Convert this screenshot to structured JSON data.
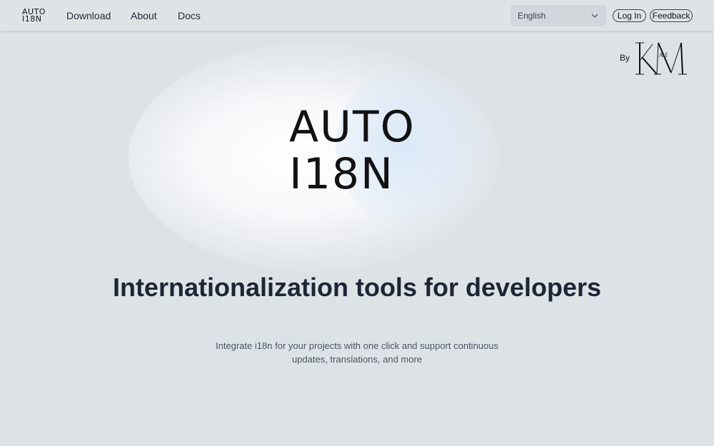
{
  "header": {
    "brand": {
      "line1": "AUTO",
      "line2": "I18N"
    },
    "nav": [
      {
        "label": "Download"
      },
      {
        "label": "About"
      },
      {
        "label": "Docs"
      }
    ],
    "language": {
      "selected": "English",
      "icon": "chevron-down-icon"
    },
    "login_label": "Log In",
    "feedback_label": "Feedback"
  },
  "byline": {
    "by_label": "By",
    "logo_text": "KAM",
    "logo_inner": "A.I"
  },
  "hero": {
    "logo_line1": "AUTO",
    "logo_line2": "I18N",
    "headline": "Internationalization tools for developers",
    "subtext": "Integrate i18n for your projects with one click and support continuous updates, translations, and more"
  },
  "colors": {
    "background": "#dde2e6",
    "header": "#dfe3e6",
    "text_dark": "#1e2535",
    "text_muted": "#4b5563",
    "glow_blue": "#d6e6f8"
  }
}
